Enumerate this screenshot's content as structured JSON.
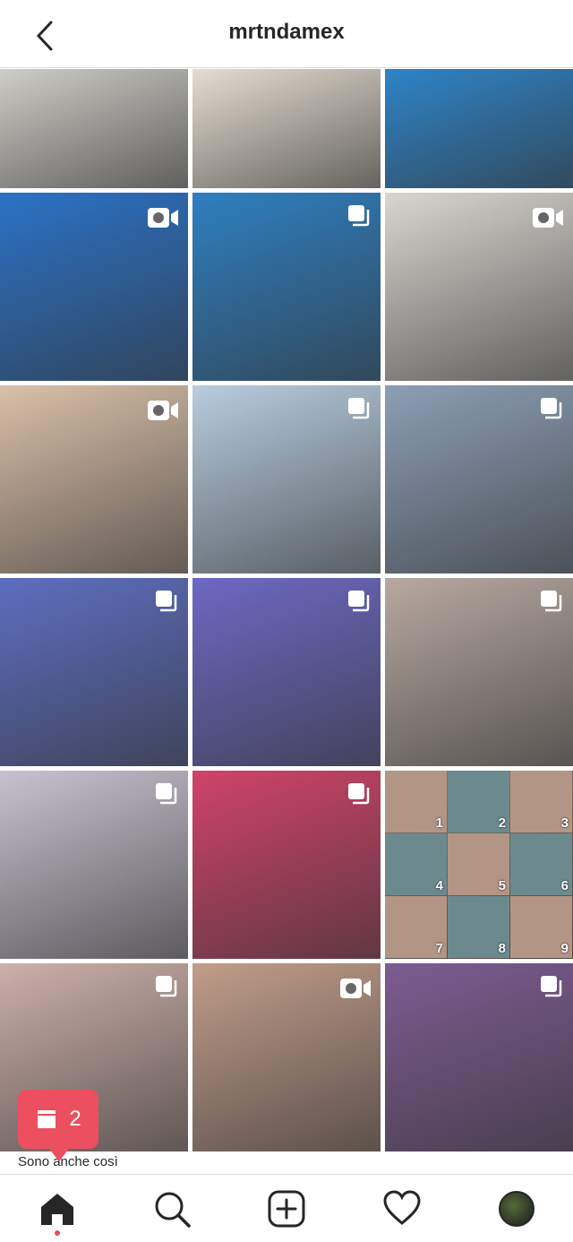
{
  "header": {
    "title": "mrtndamex"
  },
  "grid": {
    "tiles": [
      {
        "color": "#cfcdc7",
        "type": ""
      },
      {
        "color": "#e5ddd1",
        "type": ""
      },
      {
        "color": "#2e84c8",
        "type": ""
      },
      {
        "color": "#2b72c6",
        "type": "video"
      },
      {
        "color": "#2e7fc0",
        "type": "multi"
      },
      {
        "color": "#d9d6d0",
        "type": "video"
      },
      {
        "color": "#dac0a8",
        "type": "video"
      },
      {
        "color": "#b8cde0",
        "type": "multi"
      },
      {
        "color": "#8c9fb5",
        "type": "multi"
      },
      {
        "color": "#5d6ec0",
        "type": "multi"
      },
      {
        "color": "#6d68c3",
        "type": "multi"
      },
      {
        "color": "#b7a9a1",
        "type": "multi"
      },
      {
        "color": "#c8c2cf",
        "type": "multi"
      },
      {
        "color": "#d0436a",
        "type": "multi"
      },
      {
        "color": "#8a7768",
        "type": "grid9"
      },
      {
        "color": "#cdb0a9",
        "type": "multi"
      },
      {
        "color": "#c29d8a",
        "type": "video"
      },
      {
        "color": "#7d5c92",
        "type": "multi"
      }
    ],
    "grid9_labels": [
      "1",
      "2",
      "3",
      "4",
      "5",
      "6",
      "7",
      "8",
      "9"
    ]
  },
  "popup": {
    "count": "2",
    "caption": "Sono anche così"
  },
  "tabbar": {
    "items": [
      "home-icon",
      "search-icon",
      "add-post-icon",
      "heart-icon",
      "profile-avatar"
    ]
  }
}
